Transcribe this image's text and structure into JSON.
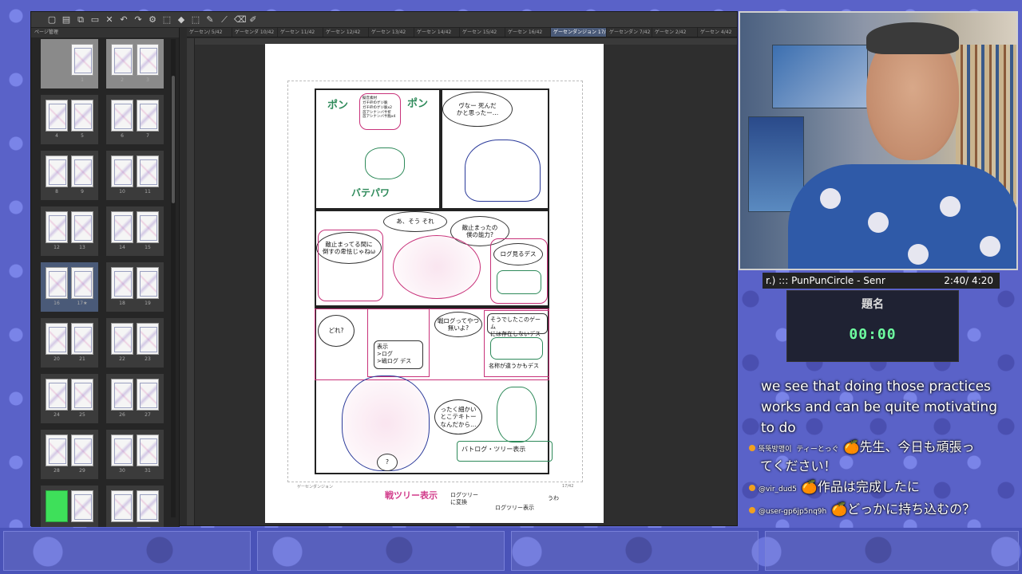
{
  "app": {
    "panel_title": "ページ管理",
    "tabs": [
      "ゲーセン/ 5/42",
      "ゲーセンダ 10/42",
      "ゲーセン 11/42",
      "ゲーセン 12/42",
      "ゲーセン 13/42",
      "ゲーセン 14/42",
      "ゲーセン 15/42",
      "ゲーセン 16/42",
      "ゲーセンダンジョン 17/42",
      "ゲーセンダン 7/42",
      "ゲーセン 2/42",
      "ゲーセン 4/42",
      "ゲーセン 3/42"
    ],
    "active_tab_index": 8,
    "thumbnails": [
      {
        "left": "",
        "right": "1"
      },
      {
        "left": "2",
        "right": "3"
      },
      {
        "left": "4",
        "right": "5"
      },
      {
        "left": "6",
        "right": "7"
      },
      {
        "left": "8",
        "right": "9"
      },
      {
        "left": "10",
        "right": "11"
      },
      {
        "left": "12",
        "right": "13"
      },
      {
        "left": "14",
        "right": "15"
      },
      {
        "left": "16",
        "right": "17★"
      },
      {
        "left": "18",
        "right": "19"
      },
      {
        "left": "20",
        "right": "21"
      },
      {
        "left": "22",
        "right": "23"
      },
      {
        "left": "24",
        "right": "25"
      },
      {
        "left": "26",
        "right": "27"
      },
      {
        "left": "28",
        "right": "29"
      },
      {
        "left": "30",
        "right": "31"
      },
      {
        "left": "",
        "right": ""
      },
      {
        "left": "",
        "right": ""
      }
    ]
  },
  "manga": {
    "memo": "擬音素材\nガチ砕のゲジ脆\nガチ砕のゲジ脆x2\n首アシナンバサ折\n首アシナンバサ脆x4",
    "sfx_top": "ポン",
    "sfx_top2": "ポン",
    "sfx_bottom": "バテパワ",
    "b1": "ヴなー 死んだ\nかと思ったー…",
    "b2": "あ、そう それ",
    "b3": "敵止まったの\n僕の能力?",
    "b4": "敵止まってる間に\n倒すの卑怯じゃねω",
    "b5": "ログ見るデス",
    "b6": "どれ?",
    "b7": "戦ログってやつ無いよ?",
    "b8": "そうでしたこのゲーム\nには存在しないデス",
    "b9": "表示\n>ログ\n>戦ログ デス",
    "b10": "名称が違うかもデス",
    "b11": "ったく細かい\nとこテキトー\nなんだから…",
    "b12": "バトログ・ツリー表示",
    "b13": "?",
    "note_bottom1": "戦ツリー表示",
    "note_bottom2": "ログツリー\nに変換",
    "note_bottom3": "ログツリー表示",
    "note_bottom4": "うわ",
    "page_footer_left": "ゲーセンダンジョン",
    "page_footer_right": "17/42"
  },
  "stream": {
    "music_title": "r.)  :::  PunPunCircle - Senr",
    "music_time": "2:40/ 4:20",
    "timer_title": "題名",
    "timer_value": "00:00",
    "caption": "we see that doing those practices works and can be quite motivating to do",
    "chat": [
      {
        "user": "뚝뚝방맹이",
        "text": "ティーとっぐ",
        "emote": "🍊",
        "message": "先生、今日も頑張っ"
      },
      {
        "user": "",
        "text": "",
        "emote": "",
        "message": "てください！"
      },
      {
        "user": "@vir_dud5",
        "text": "",
        "emote": "🍊",
        "message": "作品は完成したに"
      },
      {
        "user": "@user-gp6jp5nq9h",
        "text": "",
        "emote": "🍊",
        "message": "どっかに持ち込むの？"
      }
    ]
  },
  "colors": {
    "accent_pink": "#c8327a",
    "accent_green": "#2e8a5a",
    "timer_green": "#6effa0",
    "overlay_blue": "#5a62c8"
  }
}
